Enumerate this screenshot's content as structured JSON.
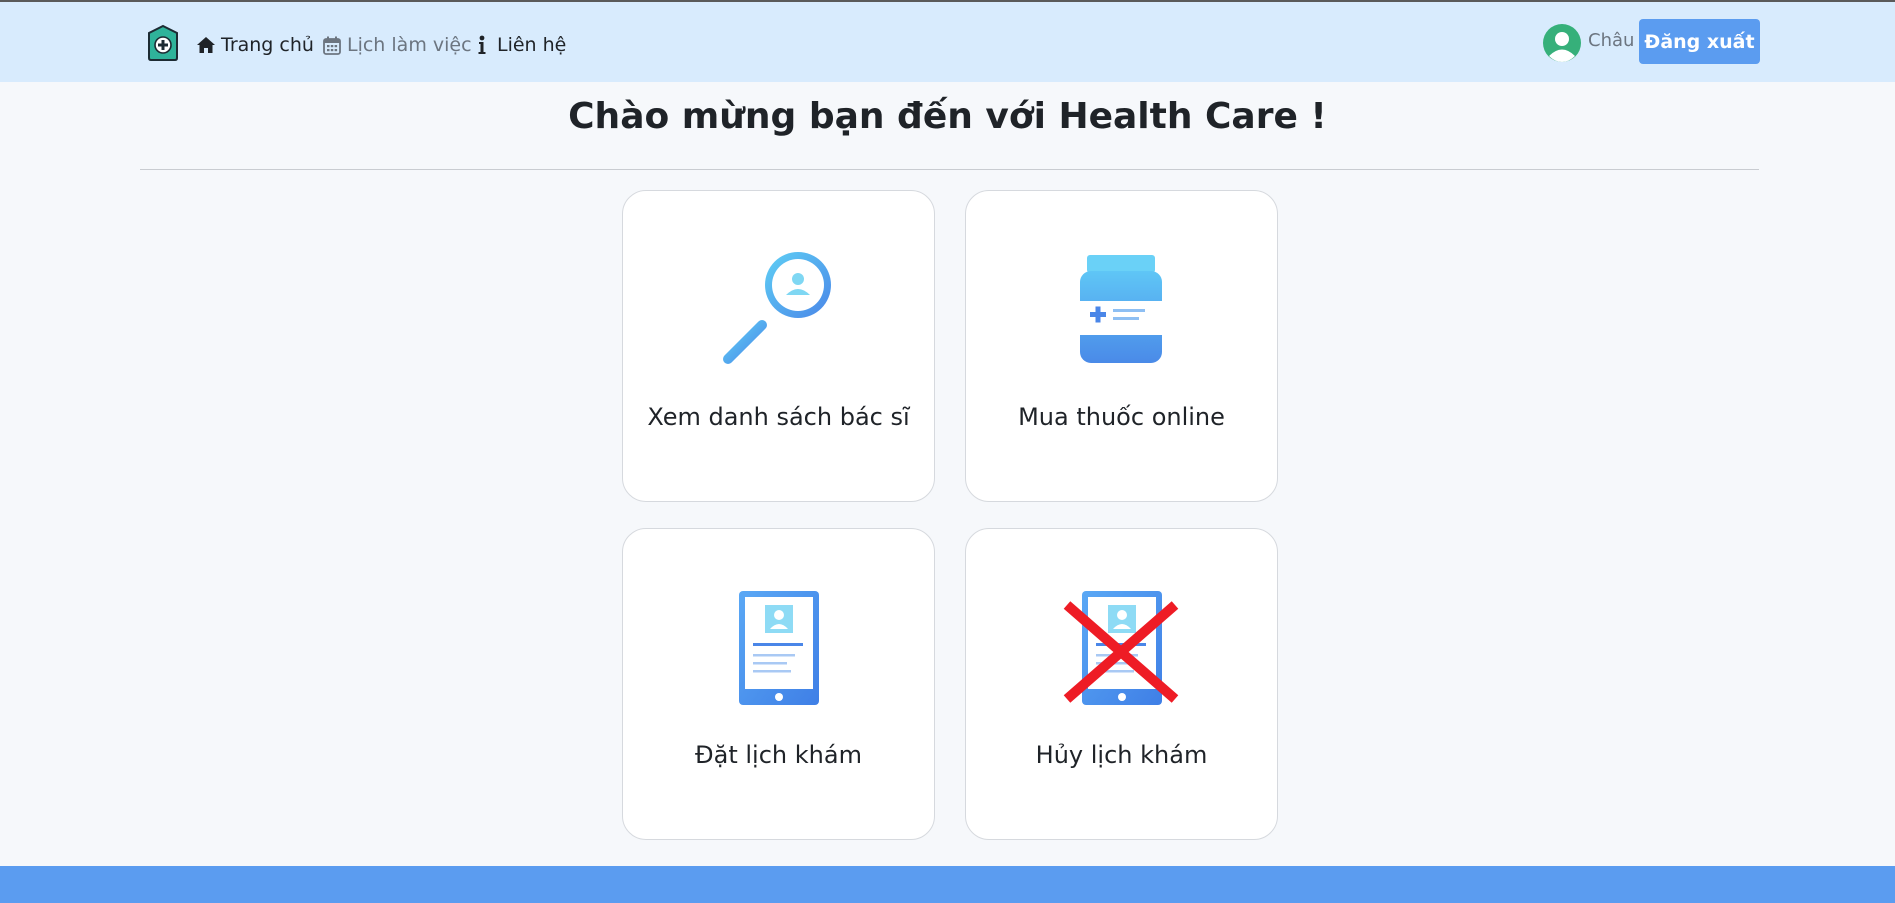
{
  "nav": {
    "home_label": "Trang chủ",
    "schedule_label": "Lịch làm việc",
    "contact_label": "Liên hệ"
  },
  "user": {
    "name": "Châu",
    "logout_label": "Đăng xuất"
  },
  "main": {
    "title": "Chào mừng bạn đến với Health Care !",
    "cards": [
      {
        "label": "Xem danh sách bác sĩ",
        "icon": "doctor-search-icon"
      },
      {
        "label": "Mua thuốc online",
        "icon": "medicine-bottle-icon"
      },
      {
        "label": "Đặt lịch khám",
        "icon": "appointment-tablet-icon"
      },
      {
        "label": "Hủy lịch khám",
        "icon": "cancel-appointment-icon"
      }
    ]
  },
  "colors": {
    "navbar_bg": "#d8ebfd",
    "accent": "#5b9cf0",
    "footer_bg": "#5b9cf0",
    "cancel_red": "#ee1c25"
  }
}
